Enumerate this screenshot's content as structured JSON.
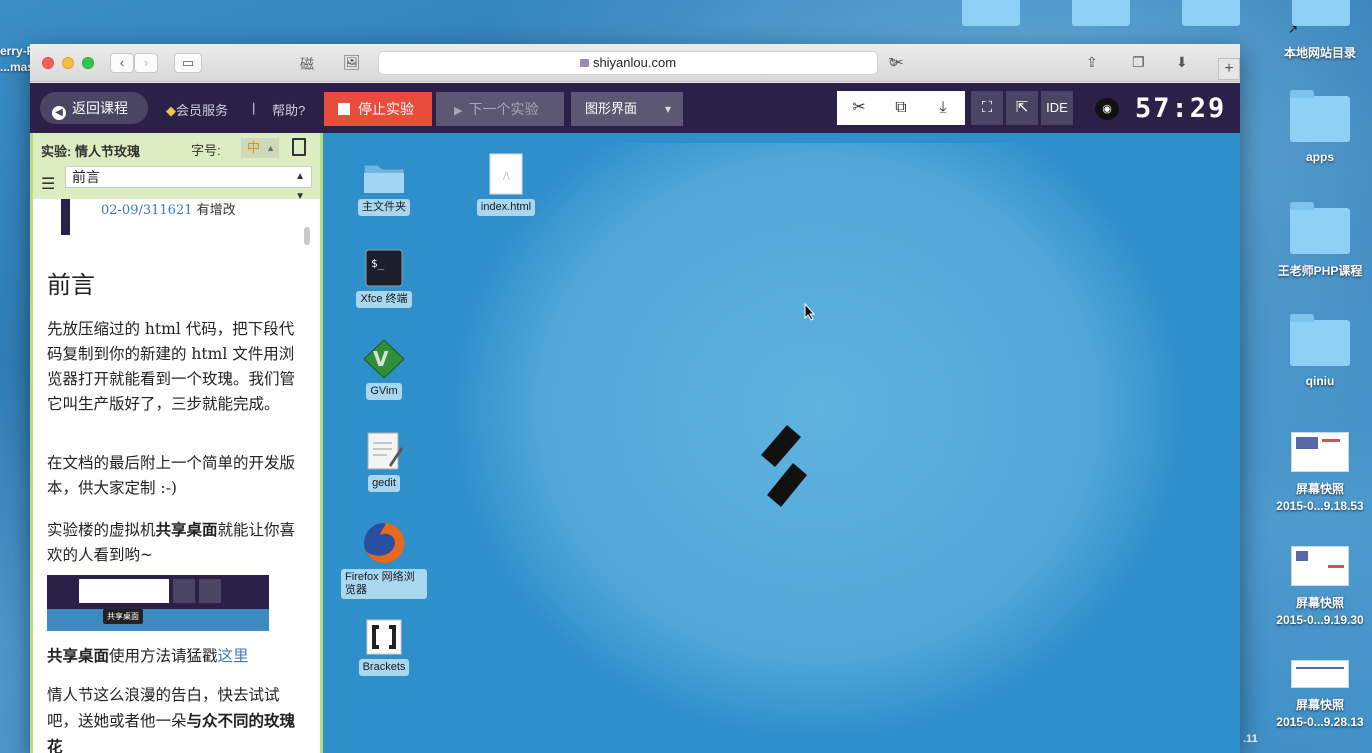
{
  "browser": {
    "url": "shiyanlou.com",
    "tab_glyph": "磁",
    "new_tab": "+"
  },
  "lab_toolbar": {
    "back_label": "返回课程",
    "vip_label": "会员服务",
    "separator": "|",
    "help_label": "帮助?",
    "stop_label": "停止实验",
    "next_label": "下一个实验",
    "mode_label": "图形界面",
    "ide_label": "IDE",
    "timer": "57:29"
  },
  "doc_panel": {
    "experiment_prefix": "实验:",
    "experiment_name": "情人节玫瑰",
    "font_label": "字号:",
    "font_size": "中",
    "section": "前言",
    "quote_prefix": "02-09/311621",
    "quote_suffix": "有增改",
    "heading": "前言",
    "para1": "先放压缩过的 html 代码，把下段代码复制到你的新建的 html 文件用浏览器打开就能看到一个玫瑰。我们管它叫生产版好了，三步就能完成。",
    "para2": "在文档的最后附上一个简单的开发版本，供大家定制 :-)",
    "para3_pre": "实验楼的虚拟机",
    "para3_bold": "共享桌面",
    "para3_post": "就能让你喜欢的人看到哟~",
    "mini_tooltip": "共享桌面",
    "para4_bold": "共享桌面",
    "para4_mid": "使用方法请猛戳",
    "para4_link": "这里",
    "para5_pre": "情人节这么浪漫的告白，快去试试吧，送她或者他一朵",
    "para5_bold": "与众不同的玫瑰花"
  },
  "vm_desktop": {
    "icons": [
      {
        "label": "主文件夹"
      },
      {
        "label": "index.html"
      },
      {
        "label": "Xfce 终端"
      },
      {
        "label": "GVim"
      },
      {
        "label": "gedit"
      },
      {
        "label": "Firefox 网络浏览器"
      },
      {
        "label": "Brackets"
      }
    ]
  },
  "mac_desktop": {
    "left_label_1": "erry-F",
    "left_label_2": "...mas",
    "items": [
      {
        "label": "本地网站目录"
      },
      {
        "label": "apps"
      },
      {
        "label": "王老师PHP课程"
      },
      {
        "label": "qiniu"
      },
      {
        "label": "屏幕快照",
        "sub": "2015-0...9.18.53"
      },
      {
        "label": "屏幕快照",
        "sub": "2015-0...9.19.30"
      },
      {
        "label": "屏幕快照",
        "sub": "2015-0...9.28.13"
      }
    ],
    "stray_text": ".11"
  }
}
